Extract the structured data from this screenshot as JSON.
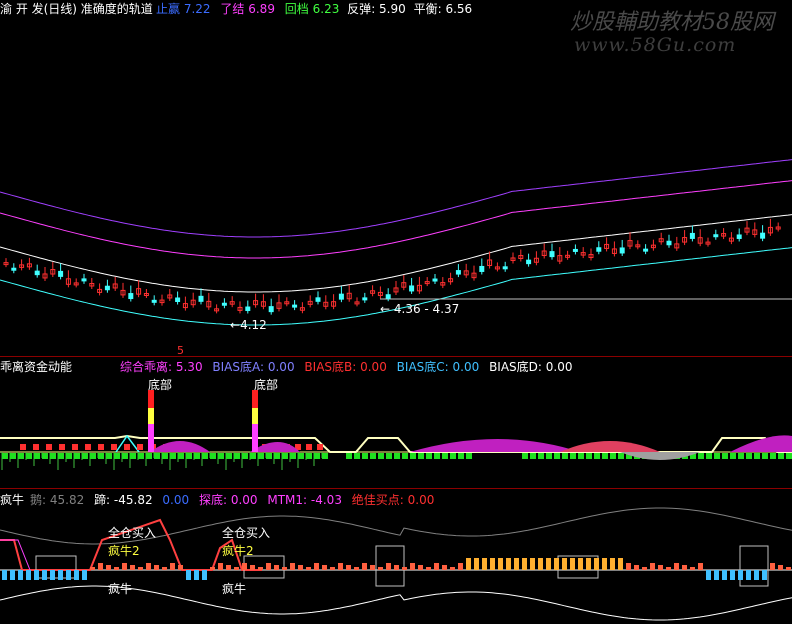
{
  "main_panel": {
    "title_prefix": "渝 开 发(日线) 准确度的轨道",
    "legend": [
      {
        "label": "止赢",
        "value": "7.22",
        "color": "#3b6cff"
      },
      {
        "label": "了结",
        "value": "6.89",
        "color": "#ff40ff"
      },
      {
        "label": "回档",
        "value": "6.23",
        "color": "#40ff40"
      },
      {
        "label": "反弹",
        "value": "5.90",
        "color": "#ffffff"
      },
      {
        "label": "平衡",
        "value": "6.56",
        "color": "#ffffff"
      }
    ],
    "annotations": [
      "4.12",
      "4.36 - 4.37"
    ],
    "marker": "5"
  },
  "watermark": {
    "brand": "炒股輔助教材58股网",
    "url": "www.58Gu.com"
  },
  "panel2": {
    "title": "乖离资金动能",
    "legend": [
      {
        "text": "综合乖离: 5.30",
        "color": "#ff40ff"
      },
      {
        "text": "BIAS底A: 0.00",
        "color": "#8080ff"
      },
      {
        "text": "BIAS底B: 0.00",
        "color": "#ff3030"
      },
      {
        "text": "BIAS底C: 0.00",
        "color": "#40c0ff"
      },
      {
        "text": "BIAS底D: 0.00",
        "color": "#ffffff"
      }
    ],
    "bottom_labels": [
      "底部",
      "底部"
    ]
  },
  "panel3": {
    "title": "疯牛",
    "legend": [
      {
        "text": "鹅: 45.82",
        "color": "#808080"
      },
      {
        "text": "蹄: -45.82",
        "color": "#ffffff"
      },
      {
        "text": "0.00",
        "color": "#3b6cff"
      },
      {
        "text": "探底: 0.00",
        "color": "#ff40ff"
      },
      {
        "text": "MTM1: -4.03",
        "color": "#ff40ff"
      },
      {
        "text": "绝佳买点: 0.00",
        "color": "#ff3030"
      }
    ],
    "buy_labels": [
      "全仓买入",
      "全仓买入"
    ],
    "bull2_labels": [
      "疯牛2",
      "疯牛2"
    ],
    "bull_labels": [
      "疯牛",
      "疯牛"
    ]
  },
  "colors": {
    "separator": "#8b0000",
    "up": "#ff3030",
    "down": "#40ffff",
    "magenta": "#c020c0"
  }
}
